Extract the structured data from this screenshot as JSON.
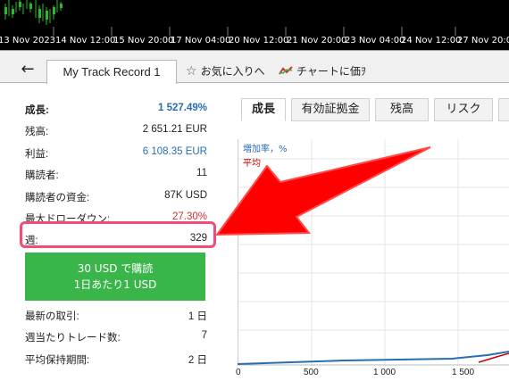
{
  "time_axis": [
    "13 Nov 2023",
    "14 Nov 12:00",
    "15 Nov 20:00",
    "17 Nov 04:00",
    "20 Nov 12:00",
    "21 Nov 20:00",
    "23 Nov 04:00",
    "24 Nov 12:00",
    "27 Nov 20:00"
  ],
  "tabbar": {
    "back_icon": "arrow-left-icon",
    "doc_tab": "My Track Record 1",
    "favorites": "お気に入りへ",
    "chart_link": "チャートに価ｦ"
  },
  "stats_top": [
    {
      "label": "成長:",
      "value": "1 527.49%"
    },
    {
      "label": "残高:",
      "value": "2 651.21 EUR"
    },
    {
      "label": "利益:",
      "value": "6 108.35 EUR"
    },
    {
      "label": "購読者:",
      "value": "11"
    },
    {
      "label": "購読者の資金:",
      "value": "87K USD"
    },
    {
      "label": "最大ドローダウン:",
      "value": "27.30%"
    },
    {
      "label": "週:",
      "value": "329"
    }
  ],
  "subscribe": {
    "line1": "30 USD で購読",
    "line2": "1日あたり1 USD"
  },
  "stats_bottom": [
    {
      "label": "最新の取引:",
      "value": "1 日"
    },
    {
      "label": "週当たりトレード数:",
      "value": "7"
    },
    {
      "label": "平均保持期間:",
      "value": "2 日"
    }
  ],
  "right_tabs": [
    "成長",
    "有効証拠金",
    "残高",
    "リスク"
  ],
  "chart_data": {
    "type": "line",
    "series": [
      {
        "name": "増加率，%",
        "color": "#2a6cb0"
      },
      {
        "name": "平均",
        "color": "#cc0000"
      }
    ],
    "x_ticks": [
      "0",
      "500",
      "1 000",
      "1 500"
    ]
  },
  "colors": {
    "accent": "#2a6cb0",
    "danger": "#d03030",
    "subscribe": "#3ab54a",
    "highlight": "#f04e78",
    "arrow": "#ff0000"
  }
}
